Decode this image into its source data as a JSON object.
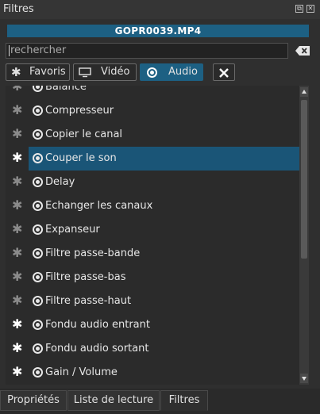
{
  "panel": {
    "title": "Filtres"
  },
  "clip": {
    "name": "GOPR0039.MP4"
  },
  "search": {
    "value": "rechercher"
  },
  "filter_tabs": {
    "favoris": "Favoris",
    "video": "Vidéo",
    "audio": "Audio"
  },
  "filters": [
    {
      "label": "Balance",
      "favorite": false
    },
    {
      "label": "Compresseur",
      "favorite": false
    },
    {
      "label": "Copier le canal",
      "favorite": false
    },
    {
      "label": "Couper le son",
      "favorite": true,
      "selected": true
    },
    {
      "label": "Delay",
      "favorite": false
    },
    {
      "label": "Echanger les canaux",
      "favorite": false
    },
    {
      "label": "Expanseur",
      "favorite": false
    },
    {
      "label": "Filtre passe-bande",
      "favorite": false
    },
    {
      "label": "Filtre passe-bas",
      "favorite": false
    },
    {
      "label": "Filtre passe-haut",
      "favorite": false
    },
    {
      "label": "Fondu audio entrant",
      "favorite": true
    },
    {
      "label": "Fondu audio sortant",
      "favorite": true
    },
    {
      "label": "Gain / Volume",
      "favorite": true
    }
  ],
  "bottom_tabs": {
    "properties": "Propriétés",
    "playlist": "Liste de lecture",
    "filters": "Filtres"
  },
  "colors": {
    "accent": "#1d6083",
    "selection": "#1a5577"
  }
}
